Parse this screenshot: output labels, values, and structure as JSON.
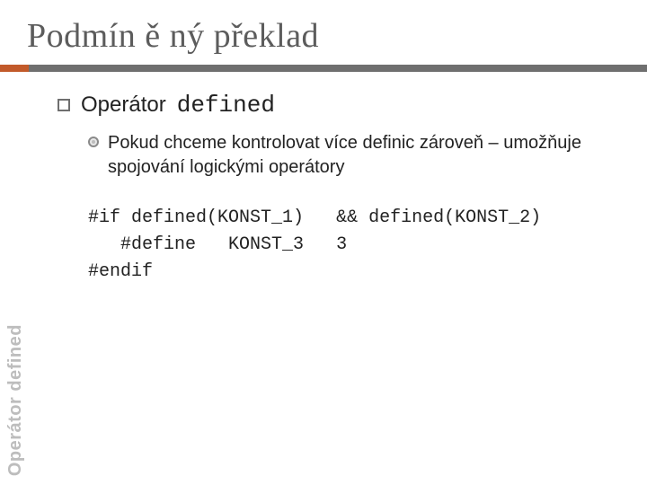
{
  "title": "Podmín ě ný překlad",
  "section": {
    "heading_prefix": "Operátor",
    "heading_code": "defined",
    "sub_text": "Pokud chceme kontrolovat více definic zároveň – umožňuje spojování logickými operátory"
  },
  "code": {
    "line1_a": "#if defined(KONST_1)",
    "line1_b": "&& defined(KONST_2)",
    "line2_a": "#define",
    "line2_b": "KONST_3",
    "line2_c": "3",
    "line3": "#endif"
  },
  "sidebar": "Operátor defined"
}
